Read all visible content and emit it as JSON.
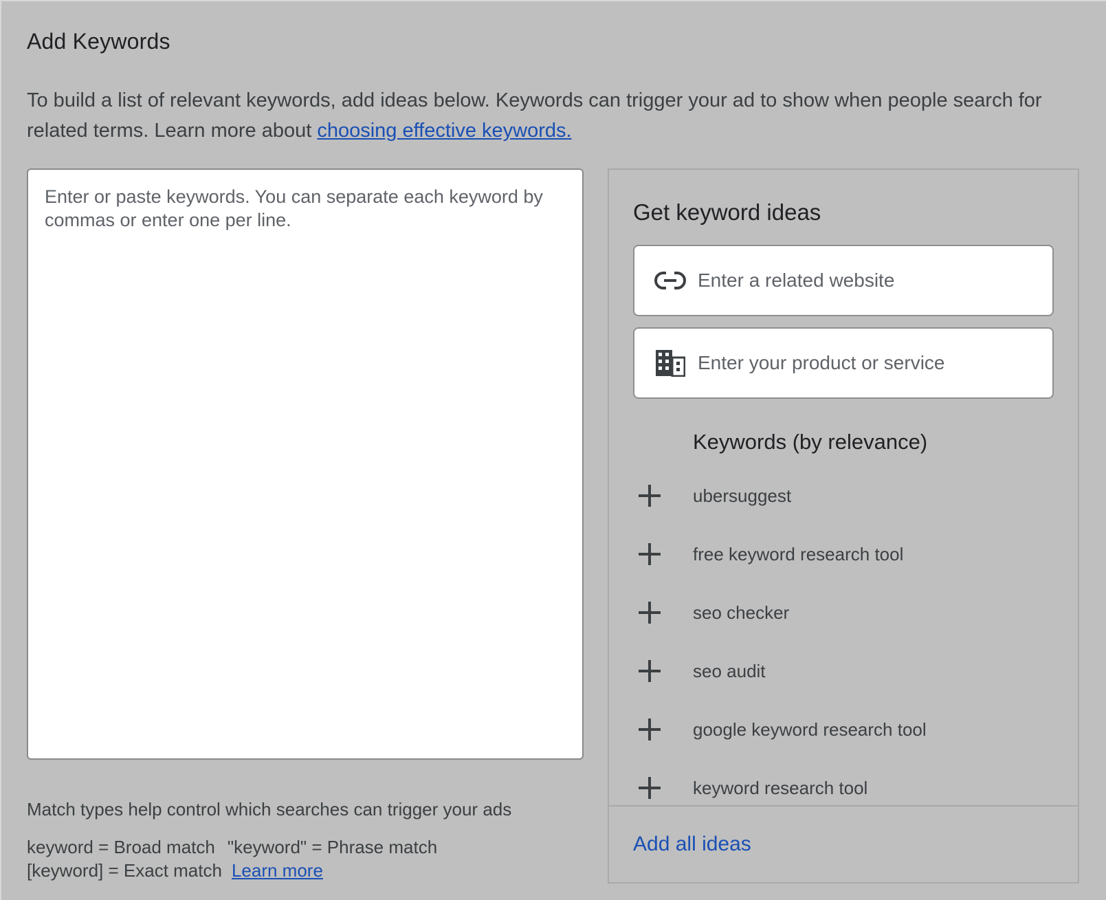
{
  "header": {
    "title": "Add Keywords",
    "intro_text": "To build a list of relevant keywords, add ideas below. Keywords can trigger your ad to show when people search for related terms. Learn more about ",
    "intro_link": "choosing effective keywords."
  },
  "editor": {
    "placeholder": "Enter or paste keywords. You can separate each keyword by commas or enter one per line."
  },
  "match_types": {
    "help": "Match types help control which searches can trigger your ads",
    "broad": "keyword = Broad match",
    "phrase": "\"keyword\" = Phrase match",
    "exact": "[keyword] = Exact match",
    "learn_more": "Learn more"
  },
  "ideas": {
    "title": "Get keyword ideas",
    "website_placeholder": "Enter a related website",
    "website_icon": "link-icon",
    "product_placeholder": "Enter your product or service",
    "product_icon": "building-icon",
    "list_header": "Keywords (by relevance)",
    "keywords": [
      "ubersuggest",
      "free keyword research tool",
      "seo checker",
      "seo audit",
      "google keyword research tool",
      "keyword research tool"
    ],
    "add_all": "Add all ideas"
  },
  "colors": {
    "background": "#bfbfbf",
    "link": "#1a4fb4",
    "text": "#3c4043"
  }
}
